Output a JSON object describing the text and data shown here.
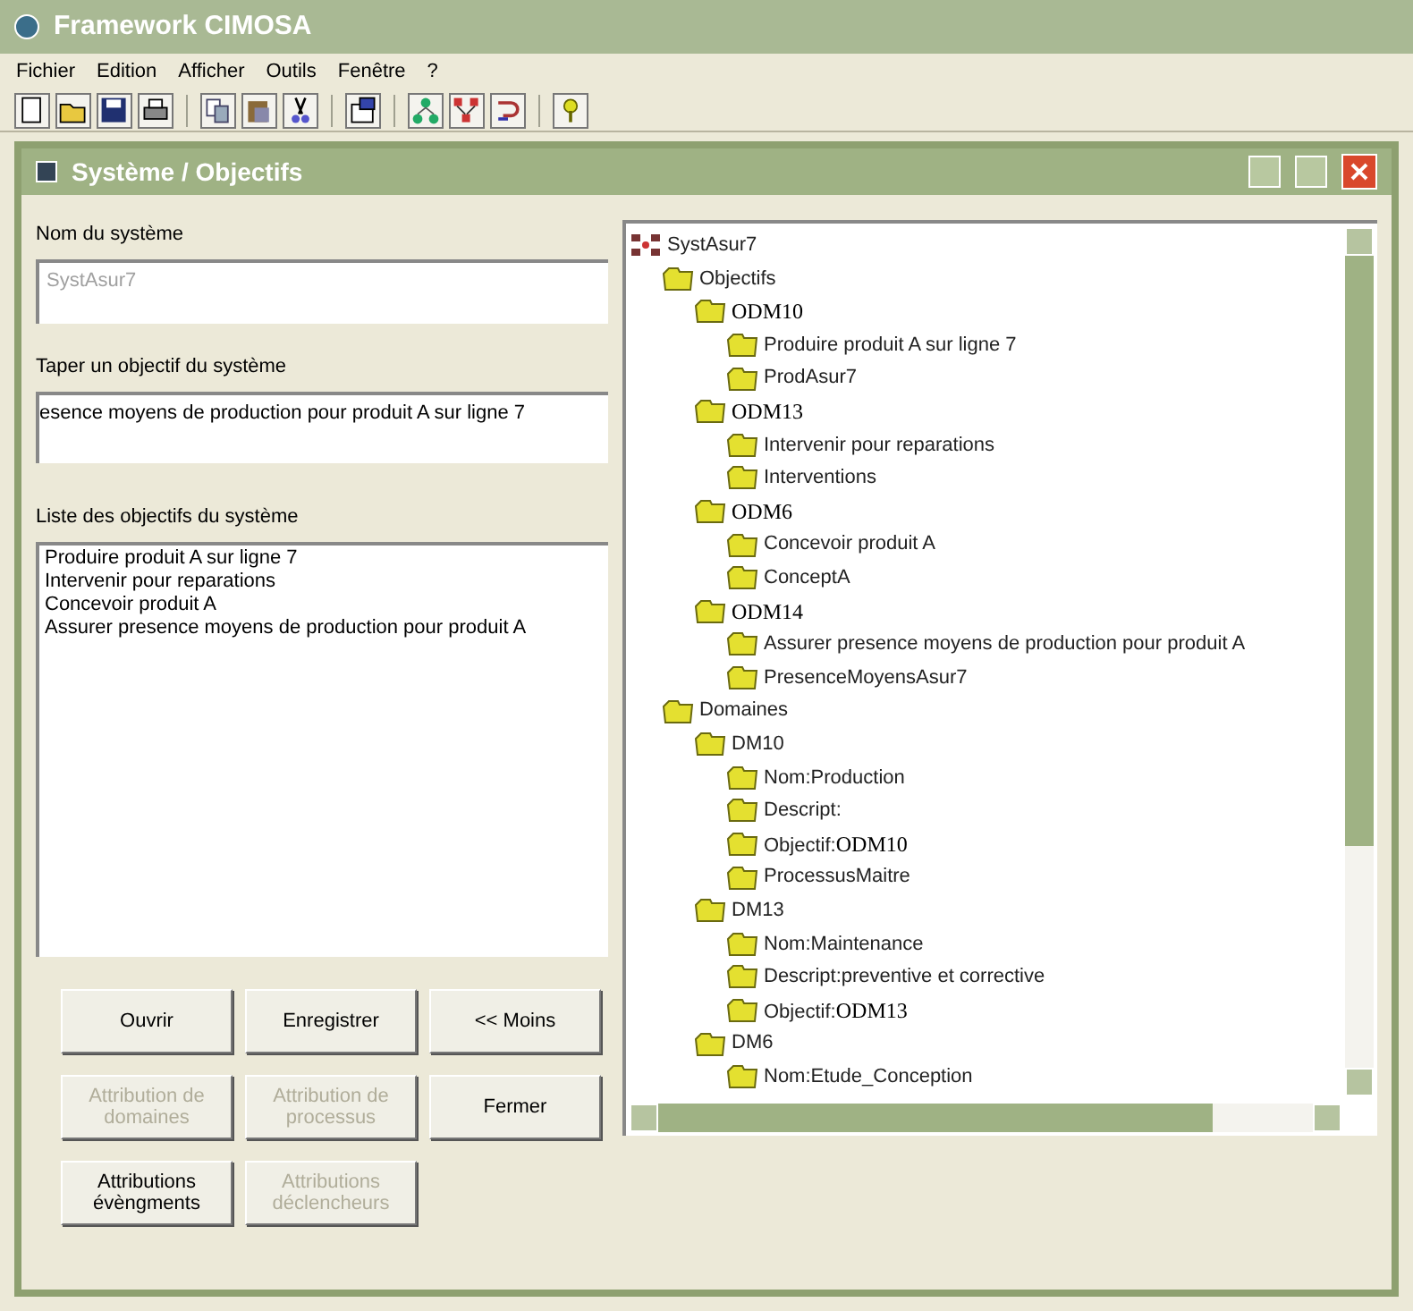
{
  "app_window": {
    "title": "Framework CIMOSA"
  },
  "menu": [
    {
      "label": "Fichier"
    },
    {
      "label": "Edition"
    },
    {
      "label": "Afficher"
    },
    {
      "label": "Outils"
    },
    {
      "label": "Fenêtre"
    },
    {
      "label": "?"
    }
  ],
  "toolbar": [
    {
      "kind": "new"
    },
    {
      "kind": "open"
    },
    {
      "kind": "save"
    },
    {
      "kind": "print"
    },
    {
      "kind": "sep"
    },
    {
      "kind": "copy"
    },
    {
      "kind": "paste"
    },
    {
      "kind": "cut"
    },
    {
      "kind": "sep"
    },
    {
      "kind": "properties"
    },
    {
      "kind": "sep"
    },
    {
      "kind": "tree"
    },
    {
      "kind": "network"
    },
    {
      "kind": "link"
    },
    {
      "kind": "sep"
    },
    {
      "kind": "help"
    }
  ],
  "dialog": {
    "title": "Système / Objectifs",
    "system_name": {
      "label": "Nom du système",
      "value": "SystAsur7",
      "disabled": true
    },
    "objective_input": {
      "label": "Taper un objectif du système",
      "value": "esence moyens de production pour produit A sur ligne 7"
    },
    "objective_list": {
      "label": "Liste des objectifs du système",
      "items": [
        "Produire produit A sur ligne 7",
        "Intervenir pour reparations",
        "Concevoir produit A",
        "Assurer presence moyens de production pour produit A"
      ]
    },
    "buttons": [
      {
        "label": "Ouvrir",
        "disabled": false
      },
      {
        "label": "Enregistrer",
        "disabled": false
      },
      {
        "label": "<< Moins",
        "disabled": false
      },
      {
        "label": "Attribution de domaines",
        "disabled": true
      },
      {
        "label": "Attribution de processus",
        "disabled": true
      },
      {
        "label": "Fermer",
        "disabled": false
      },
      {
        "label": "Attributions évèngments",
        "disabled": false
      },
      {
        "label": "Attributions déclencheurs",
        "disabled": true
      }
    ],
    "tree": {
      "root": {
        "text": "SystAsur7",
        "children": [
          {
            "text": "Objectifs",
            "children": [
              {
                "serif_text": "ODM10",
                "children": [
                  {
                    "text": "Produire produit A sur ligne 7"
                  },
                  {
                    "text": "ProdAsur7"
                  }
                ]
              },
              {
                "serif_text": "ODM13",
                "children": [
                  {
                    "text": "Intervenir pour reparations"
                  },
                  {
                    "text": "Interventions"
                  }
                ]
              },
              {
                "serif_text": "ODM6",
                "children": [
                  {
                    "text": "Concevoir produit A"
                  },
                  {
                    "text": "ConceptA"
                  }
                ]
              },
              {
                "serif_text": "ODM14",
                "children": [
                  {
                    "text": "Assurer presence moyens de production pour produit A"
                  },
                  {
                    "text": "PresenceMoyensAsur7"
                  }
                ]
              }
            ]
          },
          {
            "text": "Domaines",
            "children": [
              {
                "text": "DM10",
                "children": [
                  {
                    "text": "Nom:Production"
                  },
                  {
                    "text": "Descript:"
                  },
                  {
                    "text": "Objectif:",
                    "serif_text": "ODM10"
                  },
                  {
                    "text": "ProcessusMaitre"
                  }
                ]
              },
              {
                "text": "DM13",
                "children": [
                  {
                    "text": "Nom:Maintenance"
                  },
                  {
                    "text": "Descript:preventive et corrective"
                  },
                  {
                    "text": "Objectif:",
                    "serif_text": "ODM13"
                  }
                ]
              },
              {
                "text": "DM6",
                "children": [
                  {
                    "text": "Nom:Etude_Conception"
                  }
                ]
              }
            ]
          }
        ]
      }
    }
  }
}
